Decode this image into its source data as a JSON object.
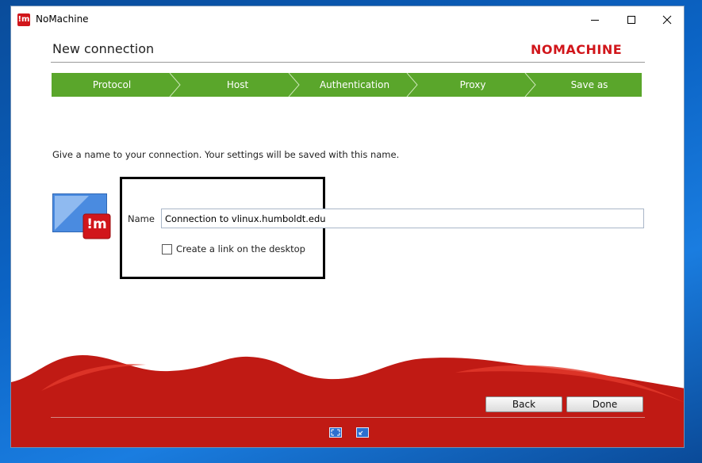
{
  "window": {
    "title": "NoMachine",
    "app_icon": "!m"
  },
  "header": {
    "title": "New connection",
    "brand": "NOMACHINE"
  },
  "steps": [
    {
      "label": "Protocol"
    },
    {
      "label": "Host"
    },
    {
      "label": "Authentication"
    },
    {
      "label": "Proxy"
    },
    {
      "label": "Save as"
    }
  ],
  "content": {
    "instruction": "Give a name to your connection. Your settings will be saved with this name.",
    "connection_icon_badge": "!m",
    "name_label": "Name",
    "name_value": "Connection to vlinux.humboldt.edu",
    "desktop_link_label": "Create a link on the desktop",
    "desktop_link_checked": false
  },
  "buttons": {
    "back": "Back",
    "done": "Done"
  },
  "colors": {
    "accent_green": "#5aa62b",
    "brand_red": "#d1161b",
    "wave_red": "#c01a14"
  }
}
